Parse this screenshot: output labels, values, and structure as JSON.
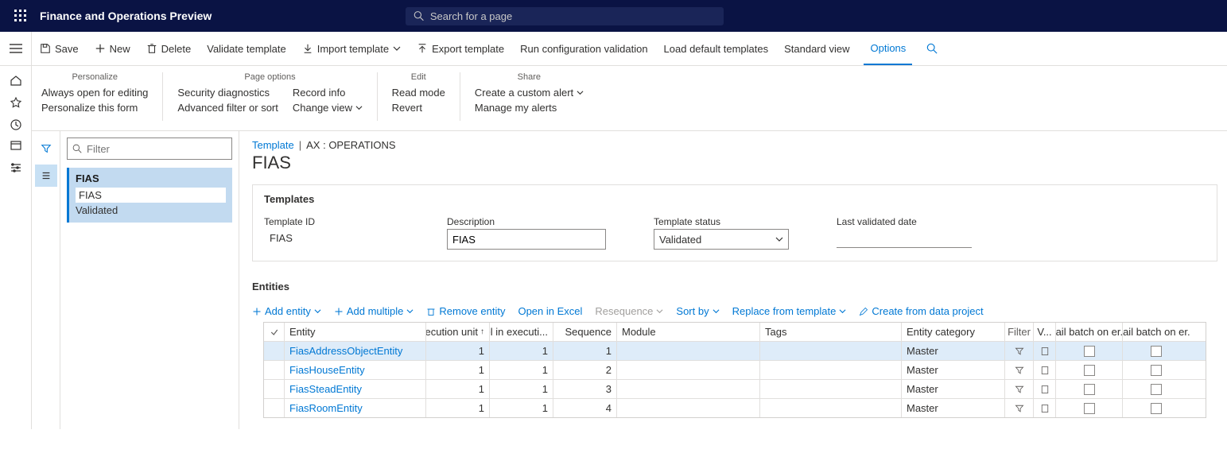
{
  "app": {
    "title": "Finance and Operations Preview",
    "search_placeholder": "Search for a page"
  },
  "cmd": {
    "save": "Save",
    "new": "New",
    "delete": "Delete",
    "validate_tpl": "Validate template",
    "import_tpl": "Import template",
    "export_tpl": "Export template",
    "run_cfg": "Run configuration validation",
    "load_def": "Load default templates",
    "std_view": "Standard view",
    "options": "Options"
  },
  "ribbon": {
    "personalize": {
      "head": "Personalize",
      "a": "Always open for editing",
      "b": "Personalize this form"
    },
    "page_options": {
      "head": "Page options",
      "a": "Security diagnostics",
      "b": "Advanced filter or sort",
      "c": "Record info",
      "d": "Change view"
    },
    "edit": {
      "head": "Edit",
      "a": "Read mode",
      "b": "Revert"
    },
    "share": {
      "head": "Share",
      "a": "Create a custom alert",
      "b": "Manage my alerts"
    }
  },
  "side": {
    "filter_placeholder": "Filter",
    "card_title": "FIAS",
    "sub1": "FIAS",
    "sub2": "Validated"
  },
  "bc": {
    "template": "Template",
    "context": "AX : OPERATIONS"
  },
  "heading": "FIAS",
  "templates": {
    "header": "Templates",
    "id_label": "Template ID",
    "id_value": "FIAS",
    "desc_label": "Description",
    "desc_value": "FIAS",
    "status_label": "Template status",
    "status_value": "Validated",
    "lvd_label": "Last validated date"
  },
  "entities": {
    "header": "Entities",
    "toolbar": {
      "add_entity": "Add entity",
      "add_multiple": "Add multiple",
      "remove": "Remove entity",
      "open_excel": "Open in Excel",
      "resequence": "Resequence",
      "sort_by": "Sort by",
      "replace_tpl": "Replace from template",
      "create_dp": "Create from data project"
    },
    "cols": {
      "entity": "Entity",
      "exec_unit": "Execution unit",
      "level": "Level in executi...",
      "sequence": "Sequence",
      "module": "Module",
      "tags": "Tags",
      "category": "Entity category",
      "filter": "Filter",
      "v": "V...",
      "fail1": "Fail batch on er...",
      "fail2": "Fail batch on er..."
    },
    "rows": [
      {
        "entity": "FiasAddressObjectEntity",
        "exec": "1",
        "level": "1",
        "seq": "1",
        "module": "",
        "tags": "",
        "cat": "Master",
        "selected": true
      },
      {
        "entity": "FiasHouseEntity",
        "exec": "1",
        "level": "1",
        "seq": "2",
        "module": "",
        "tags": "",
        "cat": "Master",
        "selected": false
      },
      {
        "entity": "FiasSteadEntity",
        "exec": "1",
        "level": "1",
        "seq": "3",
        "module": "",
        "tags": "",
        "cat": "Master",
        "selected": false
      },
      {
        "entity": "FiasRoomEntity",
        "exec": "1",
        "level": "1",
        "seq": "4",
        "module": "",
        "tags": "",
        "cat": "Master",
        "selected": false
      }
    ]
  }
}
